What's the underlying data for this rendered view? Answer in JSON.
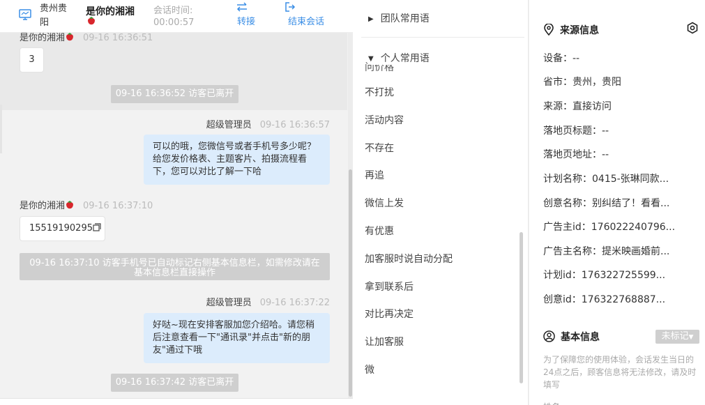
{
  "header": {
    "location": "贵州贵阳",
    "visitor_name": "是你的湘湘",
    "session_time_label": "会话时间:",
    "session_time_value": "00:00:57",
    "transfer_label": "转接",
    "end_session_label": "结束会话"
  },
  "messages": {
    "m1_sender": "是你的湘湘",
    "m1_time": "09-16 16:36:51",
    "m1_text": "3",
    "sys1": "09-16 16:36:52 访客已离开",
    "m2_sender": "超级管理员",
    "m2_time": "09-16 16:36:57",
    "m2_text": "可以的哦，您微信号或者手机号多少呢？给您发价格表、主题客片、拍摄流程看下，您可以对比了解一下哈",
    "m3_sender": "是你的湘湘",
    "m3_time": "09-16 16:37:10",
    "m3_text": "15519190295",
    "sys2": "09-16 16:37:10 访客手机号已自动标记右侧基本信息栏，如需修改请在基本信息栏直接操作",
    "m4_sender": "超级管理员",
    "m4_time": "09-16 16:37:22",
    "m4_text": "好哒~现在安排客服加您介绍哈。请您稍后注意查看一下\"通讯录\"并点击\"新的朋友\"通过下哦",
    "sys3": "09-16 16:37:42 访客已离开"
  },
  "phrases": {
    "team_group": "团队常用语",
    "personal_group": "个人常用语",
    "clipped_item": "问价格",
    "items": [
      "不打扰",
      "活动内容",
      "不存在",
      "再追",
      "微信上发",
      "有优惠",
      "加客服时说自动分配",
      "拿到联系后",
      "对比再决定",
      "让加客服",
      "微"
    ]
  },
  "info": {
    "source_title": "来源信息",
    "device": "设备：--",
    "province_city": "省市：贵州，贵阳",
    "source": "来源：直接访问",
    "landing_title": "落地页标题：--",
    "landing_url": "落地页地址：--",
    "plan_name": "计划名称：0415-张琳同款...",
    "creative_name": "创意名称：别纠结了！看看...",
    "advertiser_id": "广告主id：176022240796...",
    "advertiser_name": "广告主名称：提米映画婚前...",
    "plan_id": "计划id：176322725599...",
    "creative_id": "创意id：176322768887...",
    "basic_title": "基本信息",
    "tag_label": "未标记",
    "notice": "为了保障您的使用体验，会话发生当日的24点之后，顾客信息将无法修改，请及时填写",
    "cut_text": "姓名"
  },
  "colors": {
    "accent": "#3a8ee6",
    "bubble_agent": "#dcecfc",
    "system_notice": "#cfcfcf"
  },
  "icons": {
    "monitor": "monitor-icon",
    "transfer": "transfer-arrows-icon",
    "end": "exit-icon",
    "strawberry": "strawberry-emoji-icon",
    "copy": "copy-icon",
    "location": "location-pin-icon",
    "settings": "gear-icon",
    "user": "user-circle-icon"
  }
}
